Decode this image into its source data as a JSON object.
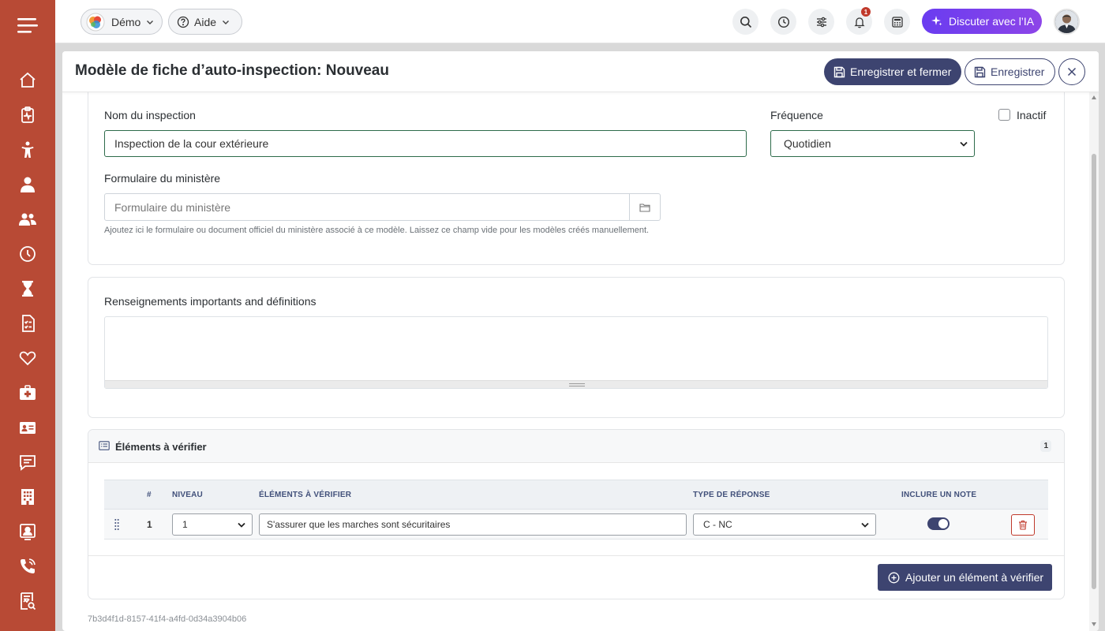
{
  "sidebar": {
    "items": [
      {
        "icon": "home-icon"
      },
      {
        "icon": "clipboard-pulse-icon"
      },
      {
        "icon": "child-icon"
      },
      {
        "icon": "staff-icon"
      },
      {
        "icon": "group-icon"
      },
      {
        "icon": "clock-icon"
      },
      {
        "icon": "hourglass-icon"
      },
      {
        "icon": "checklist-icon"
      },
      {
        "icon": "heart-icon"
      },
      {
        "icon": "first-aid-icon"
      },
      {
        "icon": "id-card-icon"
      },
      {
        "icon": "message-icon"
      },
      {
        "icon": "building-icon"
      },
      {
        "icon": "contact-card-icon"
      },
      {
        "icon": "phone-icon"
      },
      {
        "icon": "report-icon"
      }
    ]
  },
  "topbar": {
    "org_label": "Démo",
    "help_label": "Aide",
    "notification_count": "1",
    "ai_button_label": "Discuter avec l’IA"
  },
  "modal": {
    "title": "Modèle de fiche d’auto-inspection: Nouveau",
    "save_close_label": "Enregistrer et fermer",
    "save_label": "Enregistrer"
  },
  "form": {
    "name_label": "Nom du inspection",
    "name_value": "Inspection de la cour extérieure",
    "frequency_label": "Fréquence",
    "frequency_value": "Quotidien",
    "inactive_label": "Inactif",
    "ministry_label": "Formulaire du ministère",
    "ministry_placeholder": "Formulaire du ministère",
    "ministry_help": "Ajoutez ici le formulaire ou document officiel du ministère associé à ce modèle. Laissez ce champ vide pour les modèles créés manuellement.",
    "info_label": "Renseignements importants and définitions"
  },
  "items_section": {
    "title": "Éléments à vérifier",
    "count": "1",
    "columns": [
      "#",
      "NIVEAU",
      "ÉLÉMENTS À VÉRIFIER",
      "TYPE DE RÉPONSE",
      "INCLURE UN NOTE"
    ],
    "rows": [
      {
        "num": "1",
        "level": "1",
        "item": "S'assurer que les marches sont sécuritaires",
        "response_type": "C - NC",
        "include_note": true
      }
    ],
    "add_label": "Ajouter un élément à vérifier"
  },
  "record_id": "7b3d4f1d-8157-41f4-a4fd-0d34a3904b06",
  "colors": {
    "sidebar": "#b84a35",
    "primary": "#3d4470",
    "ai_gradient_start": "#6a3cf0",
    "ai_gradient_end": "#8d45e8",
    "input_border": "#2e6b4b",
    "danger": "#c0392b"
  }
}
